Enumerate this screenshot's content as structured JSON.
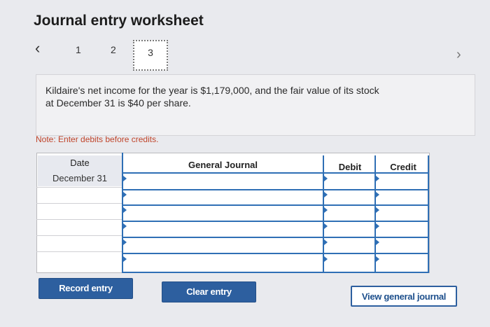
{
  "page": {
    "title": "Journal entry worksheet"
  },
  "pagination": {
    "prev_icon": "‹",
    "steps": [
      "1",
      "2",
      "3"
    ],
    "active_step": "3",
    "next_icon": "›"
  },
  "info": {
    "text_line1": "Kildaire's net income for the year is $1,179,000, and the fair value of its stock",
    "text_line2": "at December 31 is $40 per share."
  },
  "note": "Note: Enter debits before credits.",
  "table": {
    "headers": {
      "date": "Date",
      "general_journal": "General Journal",
      "debit": "Debit",
      "credit": "Credit"
    },
    "rows": [
      {
        "date": "December 31",
        "account": "",
        "debit": "",
        "credit": ""
      },
      {
        "date": "",
        "account": "",
        "debit": "",
        "credit": ""
      },
      {
        "date": "",
        "account": "",
        "debit": "",
        "credit": ""
      },
      {
        "date": "",
        "account": "",
        "debit": "",
        "credit": ""
      },
      {
        "date": "",
        "account": "",
        "debit": "",
        "credit": ""
      },
      {
        "date": "",
        "account": "",
        "debit": "",
        "credit": ""
      }
    ]
  },
  "buttons": {
    "record": "Record entry",
    "clear": "Clear entry",
    "view": "View general journal"
  },
  "colors": {
    "accent": "#2d5f9f",
    "grid_line": "#2f6fb5",
    "note": "#c0452b"
  }
}
